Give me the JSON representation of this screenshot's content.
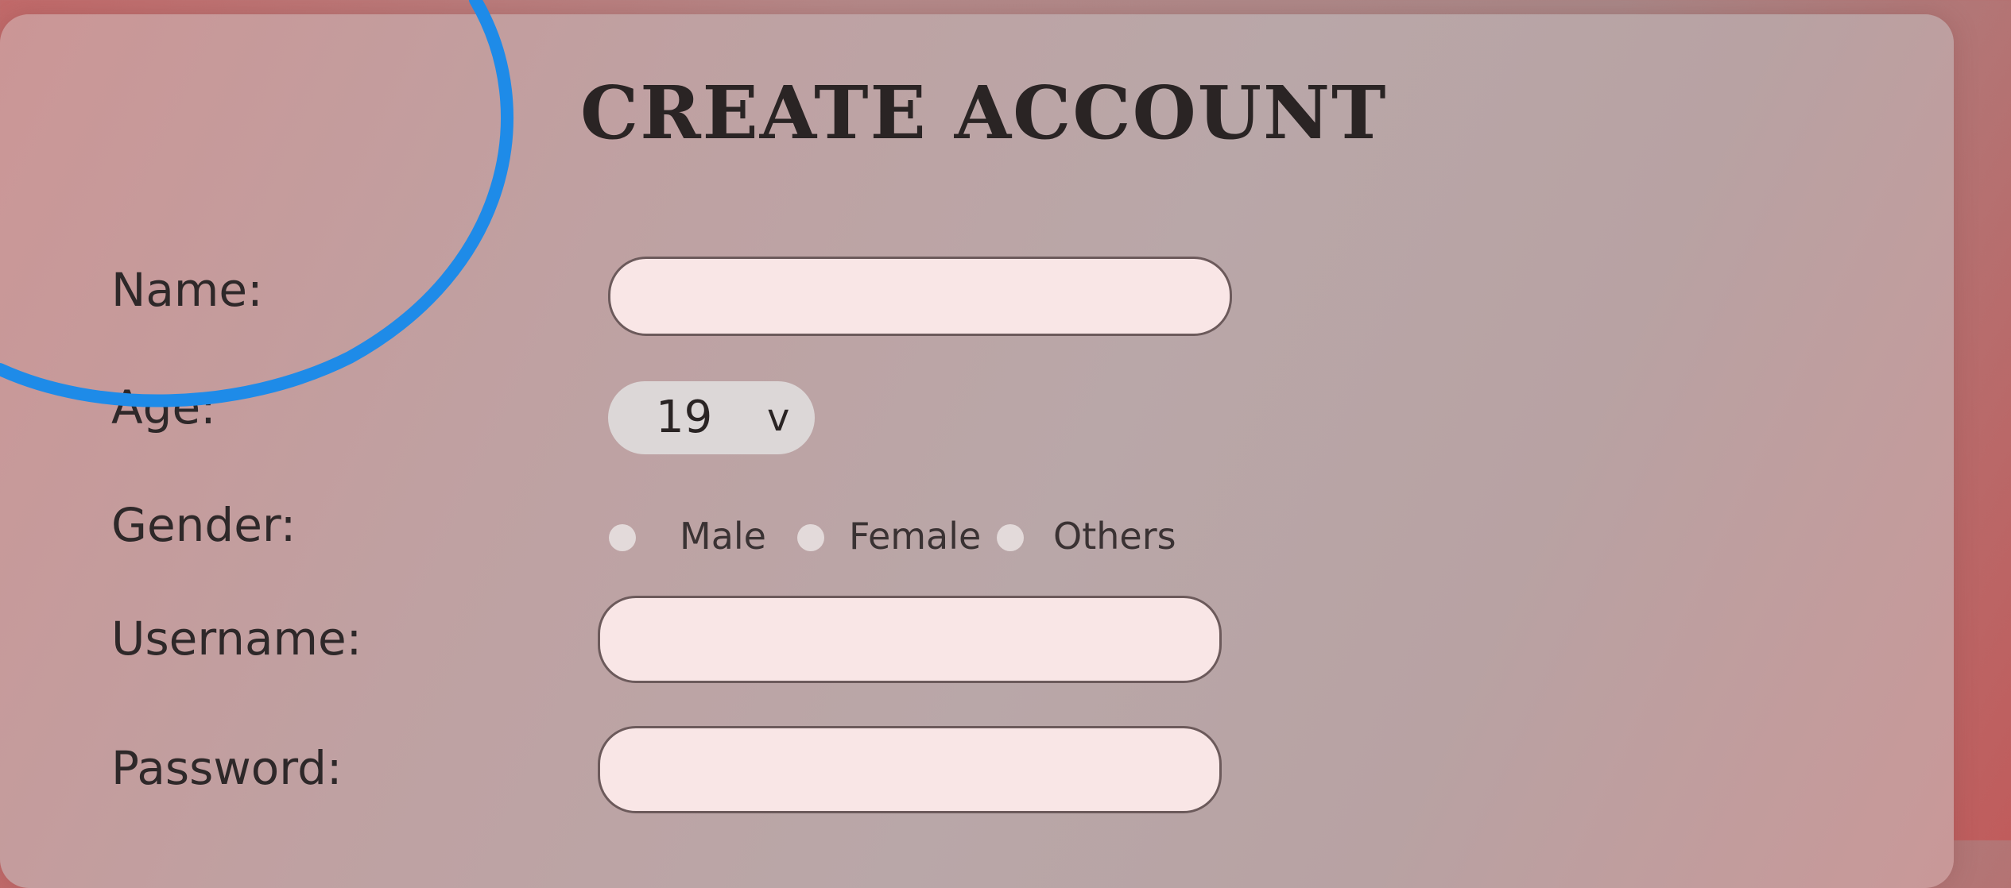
{
  "form": {
    "title": "CREATE ACCOUNT",
    "fields": {
      "name": {
        "label": "Name:",
        "value": "",
        "placeholder": ""
      },
      "age": {
        "label": "Age:",
        "selected": "19",
        "chevron": "v"
      },
      "gender": {
        "label": "Gender:",
        "options": [
          "Male",
          "Female",
          "Others"
        ]
      },
      "username": {
        "label": "Username:",
        "value": "",
        "placeholder": ""
      },
      "password": {
        "label": "Password:",
        "value": "",
        "placeholder": ""
      }
    }
  },
  "annotation": {
    "color": "#1e8be8",
    "shape": "circle-stroke"
  },
  "colors": {
    "input_fill": "#f9e6e6",
    "select_fill": "#dcd7d7",
    "title_text": "#2a2424"
  }
}
